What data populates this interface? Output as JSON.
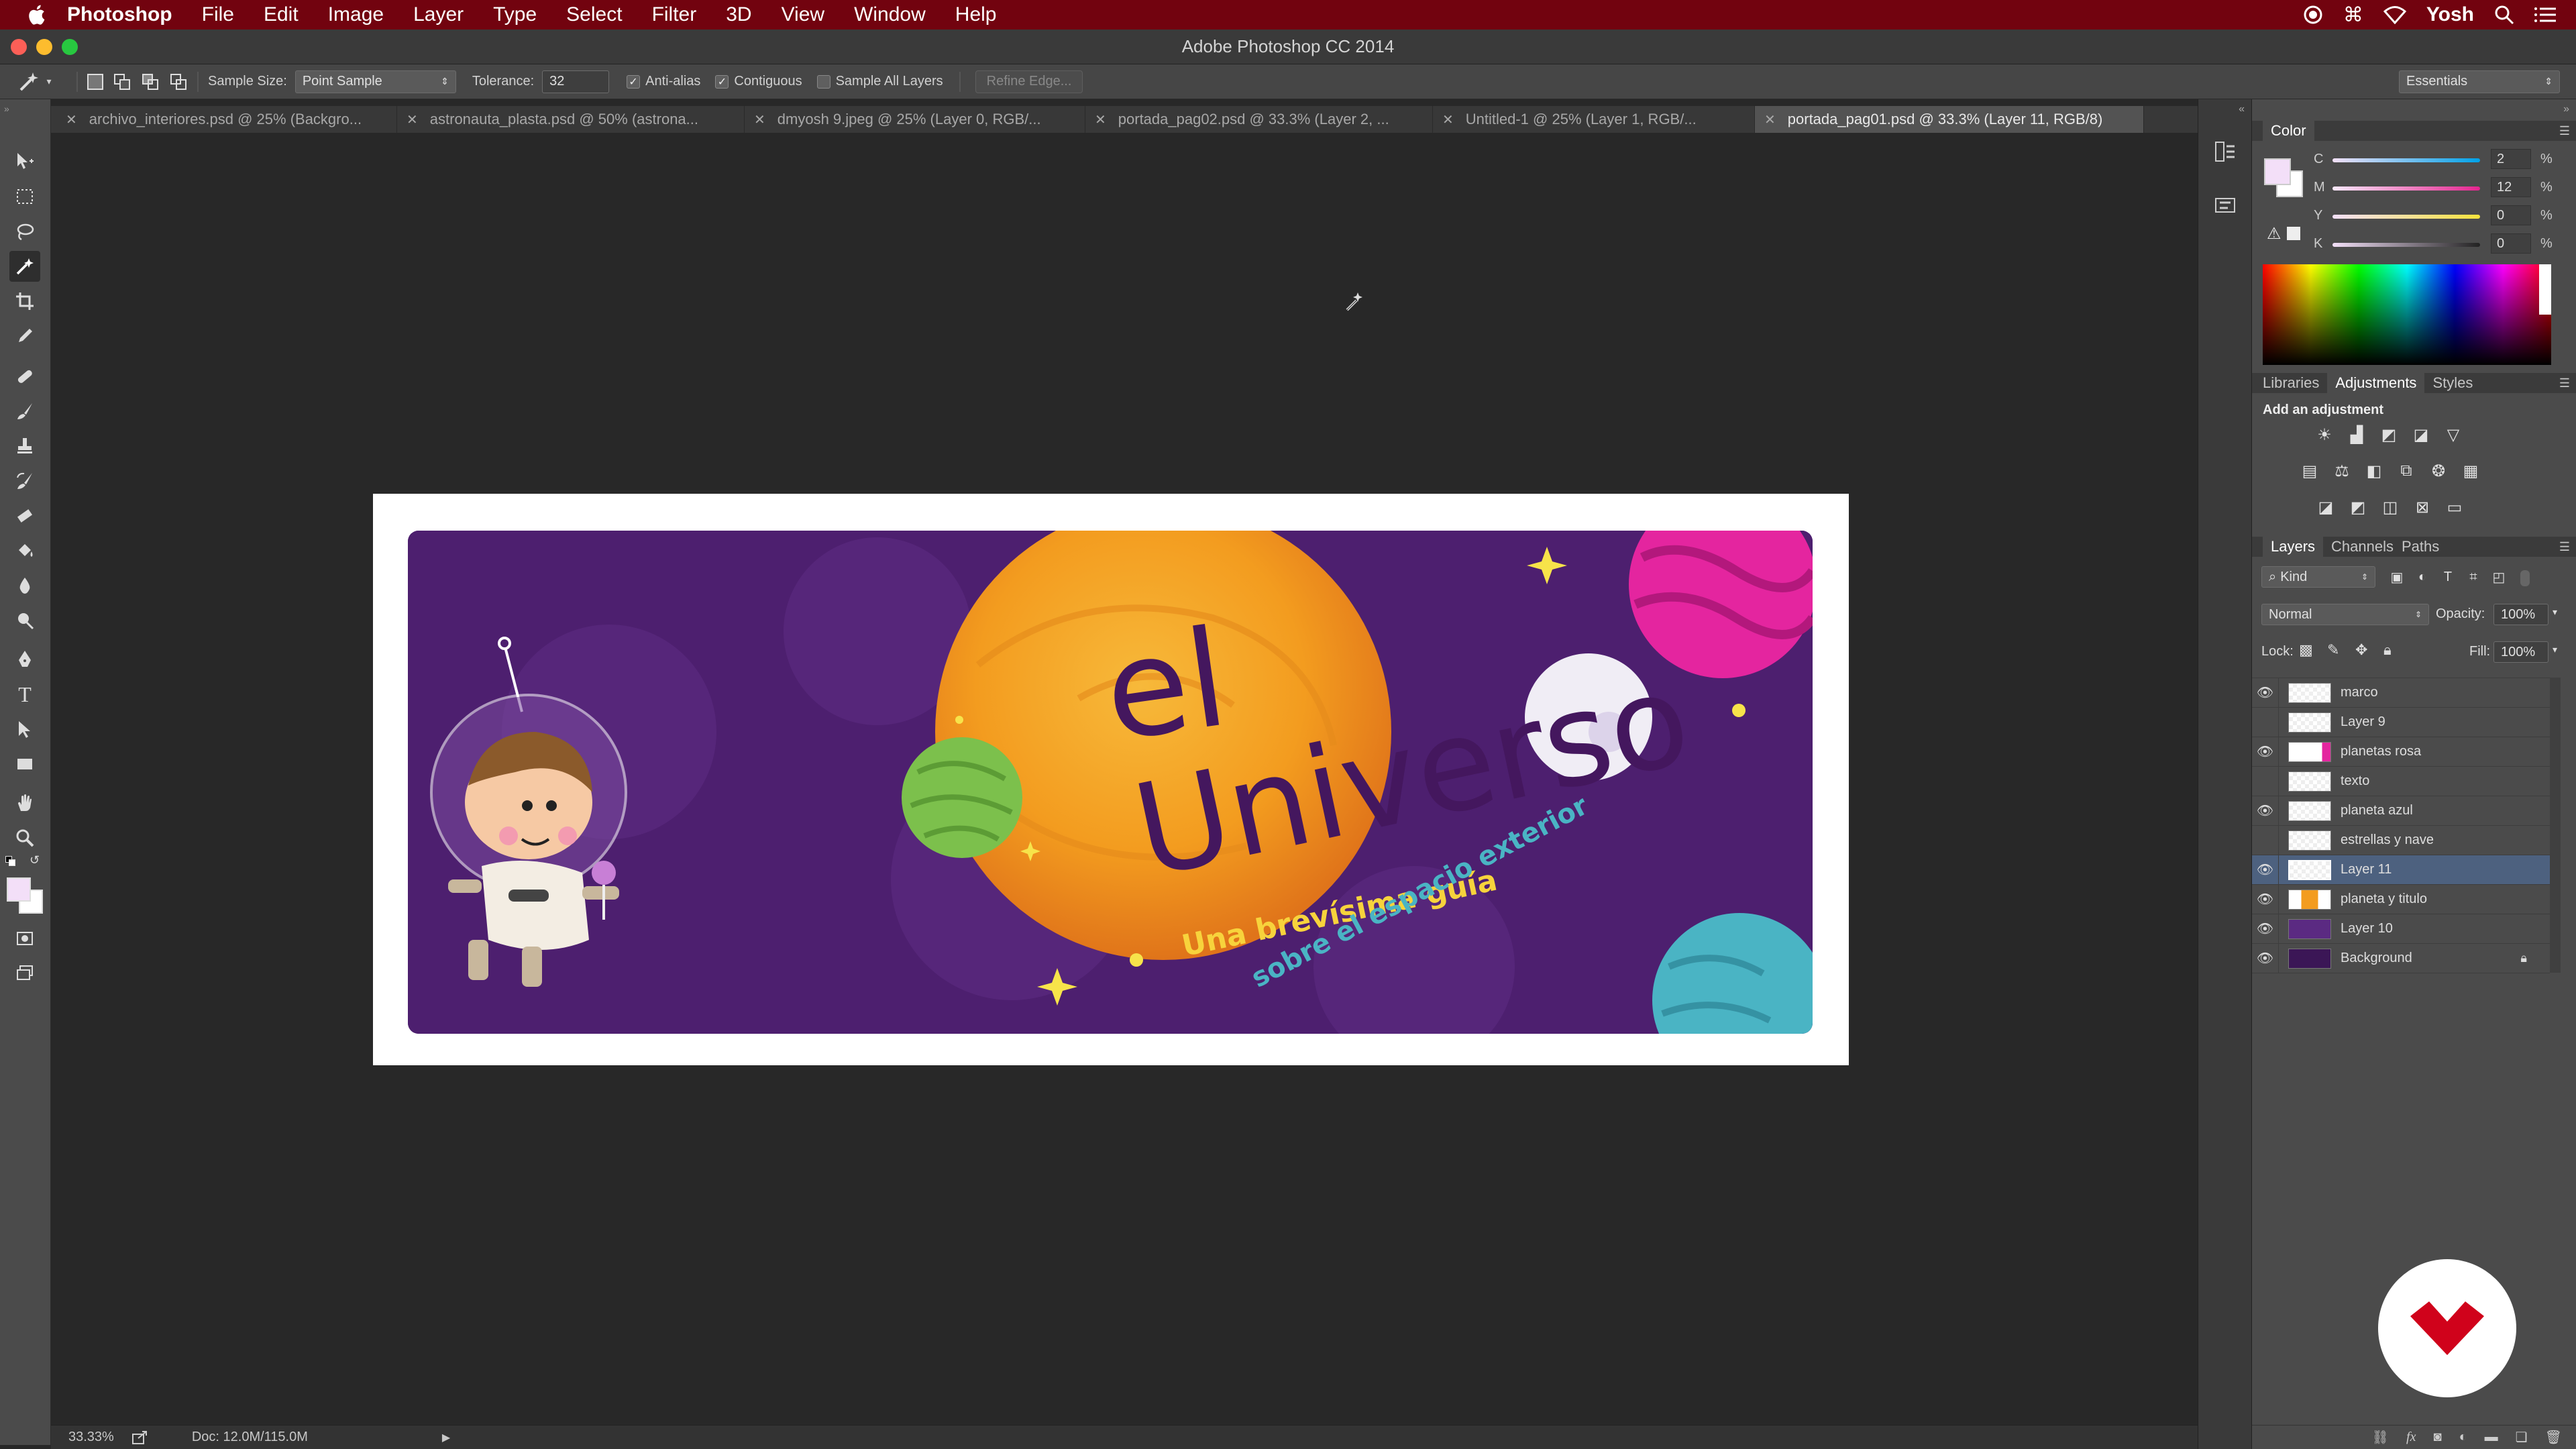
{
  "menubar": {
    "app": "Photoshop",
    "items": [
      "File",
      "Edit",
      "Image",
      "Layer",
      "Type",
      "Select",
      "Filter",
      "3D",
      "View",
      "Window",
      "Help"
    ],
    "user": "Yosh"
  },
  "window": {
    "title": "Adobe Photoshop CC 2014"
  },
  "options": {
    "sample_size_label": "Sample Size:",
    "sample_size_value": "Point Sample",
    "tolerance_label": "Tolerance:",
    "tolerance_value": "32",
    "antialias": "Anti-alias",
    "contiguous": "Contiguous",
    "sample_all": "Sample All Layers",
    "refine_edge": "Refine Edge...",
    "workspace": "Essentials"
  },
  "tabs": [
    {
      "label": "archivo_interiores.psd @ 25% (Backgro..."
    },
    {
      "label": "astronauta_plasta.psd @ 50% (astrona..."
    },
    {
      "label": "dmyosh 9.jpeg @ 25% (Layer 0, RGB/..."
    },
    {
      "label": "portada_pag02.psd @ 33.3% (Layer 2, ..."
    },
    {
      "label": "Untitled-1 @ 25% (Layer 1, RGB/..."
    },
    {
      "label": "portada_pag01.psd @ 33.3% (Layer 11, RGB/8)"
    }
  ],
  "artwork": {
    "title_el": "el",
    "title_universo": "Universo",
    "subtitle1": "Una brevísima guía",
    "subtitle2": "sobre el espacio exterior"
  },
  "status": {
    "zoom": "33.33%",
    "doc": "Doc: 12.0M/115.0M"
  },
  "color_panel": {
    "title": "Color",
    "channels": [
      {
        "label": "C",
        "value": "2"
      },
      {
        "label": "M",
        "value": "12"
      },
      {
        "label": "Y",
        "value": "0"
      },
      {
        "label": "K",
        "value": "0"
      }
    ],
    "unit": "%"
  },
  "adjust_panel": {
    "tabs": [
      "Libraries",
      "Adjustments",
      "Styles"
    ],
    "hint": "Add an adjustment"
  },
  "layers_panel": {
    "tabs": [
      "Layers",
      "Channels",
      "Paths"
    ],
    "filter": "Kind",
    "blend": "Normal",
    "opacity_label": "Opacity:",
    "opacity": "100%",
    "lock_label": "Lock:",
    "fill_label": "Fill:",
    "fill": "100%",
    "layers": [
      {
        "name": "marco",
        "visible": true
      },
      {
        "name": "Layer 9",
        "visible": false
      },
      {
        "name": "planetas rosa",
        "visible": true
      },
      {
        "name": "texto",
        "visible": false
      },
      {
        "name": "planeta azul",
        "visible": true
      },
      {
        "name": "estrellas y nave",
        "visible": false
      },
      {
        "name": "Layer 11",
        "visible": true
      },
      {
        "name": "planeta y titulo",
        "visible": true
      },
      {
        "name": "Layer 10",
        "visible": true
      },
      {
        "name": "Background",
        "visible": true
      }
    ]
  },
  "colors": {
    "menubar": "#72030f",
    "selection": "#4d617f",
    "art_bg": "#4d1f6f",
    "planet": "#f3a21f",
    "brand": "#d0021b"
  }
}
